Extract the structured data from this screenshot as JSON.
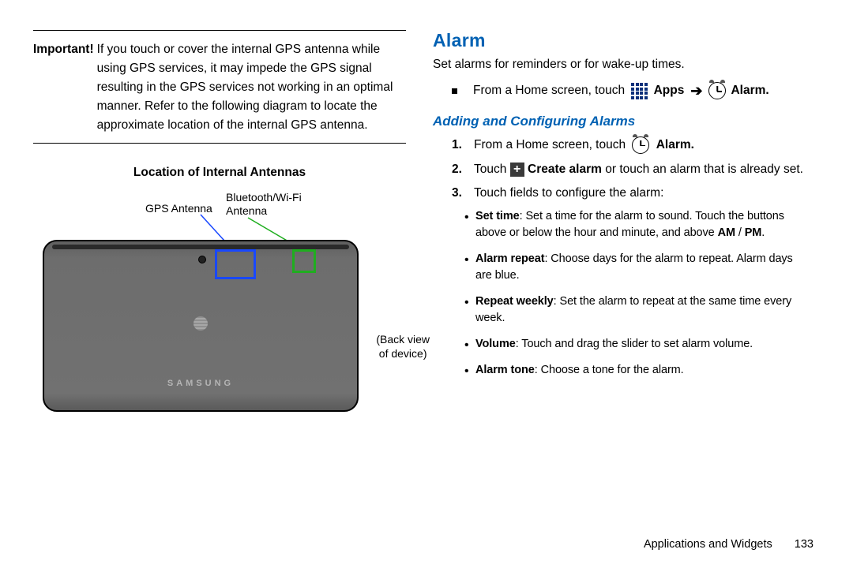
{
  "left": {
    "important_label": "Important!",
    "important_text": "If you touch or cover the internal GPS antenna while using GPS services, it may impede the GPS signal resulting in the GPS services not working in an optimal manner. Refer to the following diagram to locate the approximate location of the internal GPS antenna.",
    "antenna_heading": "Location of Internal Antennas",
    "gps_label": "GPS Antenna",
    "bt_label_l1": "Bluetooth/Wi-Fi",
    "bt_label_l2": "Antenna",
    "backview_l1": "(Back view",
    "backview_l2": "of device)",
    "brand": "SAMSUNG"
  },
  "right": {
    "heading": "Alarm",
    "intro": "Set alarms for reminders or for wake-up times.",
    "from_home_prefix": "From a Home screen, touch",
    "apps_label": "Apps",
    "alarm_label": "Alarm",
    "subhead": "Adding and Configuring Alarms",
    "steps": {
      "s1_num": "1.",
      "s1_a": "From a Home screen, touch",
      "s1_b": "Alarm",
      "s2_num": "2.",
      "s2_a": "Touch",
      "s2_b": "Create alarm",
      "s2_c": "or touch an alarm that is already set.",
      "s3_num": "3.",
      "s3_a": "Touch fields to configure the alarm:"
    },
    "opts": {
      "o1_t": "Set time",
      "o1_b": ": Set a time for the alarm to sound. Touch the buttons above or below the hour and minute, and above ",
      "o1_am": "AM",
      "o1_slash": " / ",
      "o1_pm": "PM",
      "o2_t": "Alarm repeat",
      "o2_b": ": Choose days for the alarm to repeat. Alarm days are blue.",
      "o3_t": "Repeat weekly",
      "o3_b": ": Set the alarm to repeat at the same time every week.",
      "o4_t": "Volume",
      "o4_b": ": Touch and drag the slider to set alarm volume.",
      "o5_t": "Alarm tone",
      "o5_b": ": Choose a tone for the alarm."
    }
  },
  "footer": {
    "section": "Applications and Widgets",
    "page": "133"
  }
}
